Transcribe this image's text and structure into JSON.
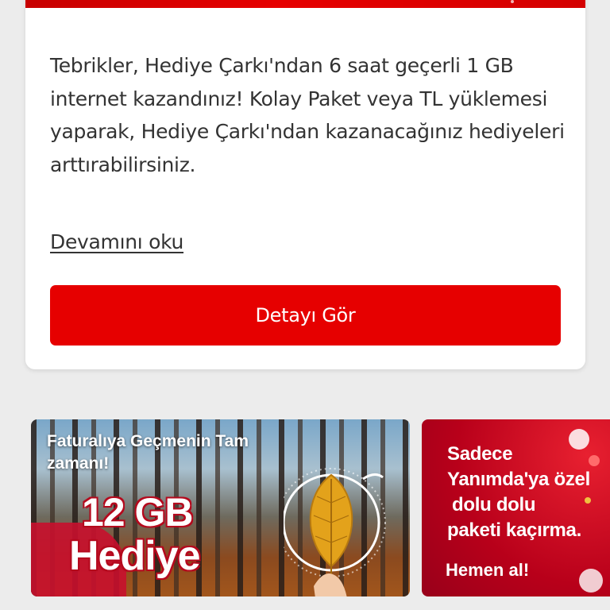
{
  "card": {
    "message": "Tebrikler, Hediye Çarkı'ndan 6 saat geçerli 1 GB internet kazandınız! Kolay Paket veya TL yüklemesi yaparak, Hediye Çarkı'ndan kazanacağınız hediyeleri arttırabilirsiniz.",
    "read_more": "Devamını oku",
    "detail_button": "Detayı Gör"
  },
  "banners": [
    {
      "headline_line1": "Faturalıya Geçmenin Tam",
      "headline_line2": "zamanı!",
      "amount": "12 GB",
      "label": "Hediye"
    },
    {
      "line1": "Sadece",
      "line2": "Yanımda'ya özel",
      "line3": "dolu dolu",
      "line4": "paketi kaçırma.",
      "cta": "Hemen al!"
    }
  ],
  "colors": {
    "brand_red": "#e60000",
    "text": "#333333",
    "background": "#ececec"
  }
}
